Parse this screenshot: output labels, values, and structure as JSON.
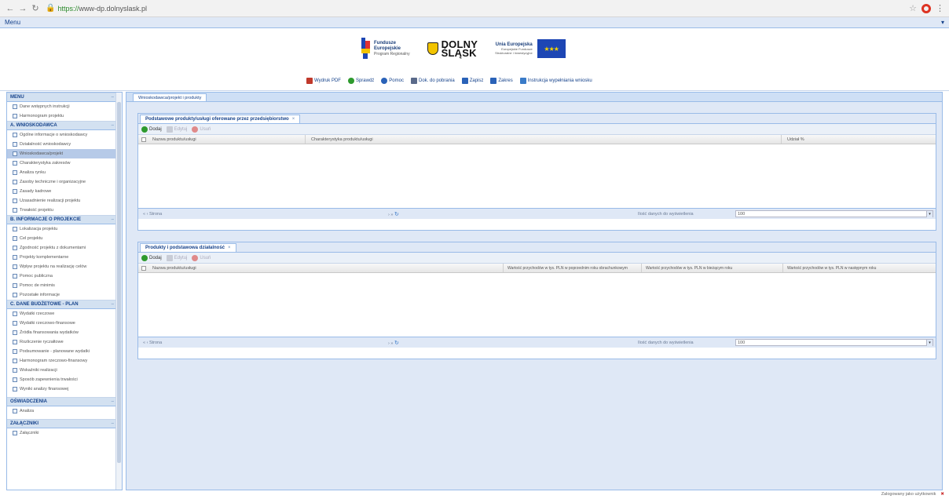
{
  "browser": {
    "url_scheme": "https://",
    "url_rest": "www-dp.dolnyslask.pl"
  },
  "appbar": {
    "title": "Menu"
  },
  "logos": {
    "fe_line1": "Fundusze",
    "fe_line2": "Europejskie",
    "fe_line3": "Program Regionalny",
    "ds_line1": "DOLNY",
    "ds_line2": "ŚLĄSK",
    "ue_line1": "Unia Europejska",
    "ue_line2": "Europejskie Fundusze",
    "ue_line3": "Strukturalne i Inwestycyjne"
  },
  "toolbar": {
    "items": [
      {
        "label": "Wydruk PDF",
        "color": "#c0392b"
      },
      {
        "label": "Sprawdź",
        "color": "#2e9a2e"
      },
      {
        "label": "Pomoc",
        "color": "#2a62b8"
      },
      {
        "label": "Dok. do pobrania",
        "color": "#5a6a8a"
      },
      {
        "label": "Zapisz",
        "color": "#2a62b8"
      },
      {
        "label": "Zakres",
        "color": "#2a62b8"
      },
      {
        "label": "Instrukcja wypełniania wniosku",
        "color": "#3a7bc8"
      }
    ]
  },
  "sidebar": {
    "pre_items": [
      {
        "label": "Dane wstępnych instrukcji"
      },
      {
        "label": "Harmonogram projektu"
      }
    ],
    "groups": [
      {
        "title": "A. WNIOSKODAWCA",
        "items": [
          {
            "label": "Ogólne informacje o wnioskodawcy"
          },
          {
            "label": "Działalność wnioskodawcy"
          },
          {
            "label": "Wnioskodawca/projekt",
            "selected": true
          },
          {
            "label": "Charakterystyka zakresów"
          },
          {
            "label": "Analiza rynku"
          },
          {
            "label": "Zasoby techniczne i organizacyjne"
          },
          {
            "label": "Zasady kadrowe"
          },
          {
            "label": "Uzasadnienie realizacji projektu"
          },
          {
            "label": "Trwałość projektu"
          }
        ]
      },
      {
        "title": "B. INFORMACJE O PROJEKCIE",
        "items": [
          {
            "label": "Lokalizacja projektu"
          },
          {
            "label": "Cel projektu"
          },
          {
            "label": "Zgodność projektu z dokumentami"
          },
          {
            "label": "Projekty komplementarne"
          },
          {
            "label": "Wpływ projektu na realizację celów"
          },
          {
            "label": "Pomoc publiczna"
          },
          {
            "label": "Pomoc de minimis"
          },
          {
            "label": "Pozostałe informacje"
          }
        ]
      },
      {
        "title": "C. DANE BUDŻETOWE - PLAN",
        "items": [
          {
            "label": "Wydatki rzeczowe"
          },
          {
            "label": "Wydatki rzeczowo-finansowe"
          },
          {
            "label": "Źródła finansowania wydatków"
          },
          {
            "label": "Rozliczenie ryczałtowe"
          },
          {
            "label": "Podsumowanie - planowane wydatki"
          },
          {
            "label": "Harmonogram rzeczowo-finansowy"
          },
          {
            "label": "Wskaźniki realizacji"
          },
          {
            "label": "Sposób zapewnienia trwałości"
          },
          {
            "label": "Wyniki analizy finansowej"
          }
        ]
      },
      {
        "title": "OŚWIADCZENIA",
        "items": [
          {
            "label": "Analiza"
          }
        ]
      },
      {
        "title": "ZAŁĄCZNIKI",
        "items": [
          {
            "label": "Załączniki"
          }
        ]
      }
    ]
  },
  "main": {
    "tab": "Wnioskodawca/projekt i produkty",
    "panels": [
      {
        "tab": "Podstawowe produkty/usługi oferowane przez przedsiębiorstwo",
        "add": "Dodaj",
        "edit": "Edytuj",
        "delete": "Usuń",
        "columns": [
          "Nazwa produktu/usługi",
          "Charakterystyka produktu/usługi",
          "Udział %"
        ],
        "pager_left": "Strona",
        "per_page_label": "Ilość danych do wyświetlenia",
        "per_page_value": "100"
      },
      {
        "tab": "Produkty i podstawowa działalność",
        "add": "Dodaj",
        "edit": "Edytuj",
        "delete": "Usuń",
        "columns": [
          "Nazwa produktu/usługi",
          "Wartość przychodów w tys. PLN w poprzednim roku obrachunkowym",
          "Wartość przychodów w tys. PLN w bieżącym roku",
          "Wartość przychodów w tys. PLN w następnym roku"
        ],
        "pager_left": "Strona",
        "per_page_label": "Ilość danych do wyświetlenia",
        "per_page_value": "100"
      }
    ]
  },
  "status": {
    "text": "Zalogowany jako użytkownik"
  }
}
